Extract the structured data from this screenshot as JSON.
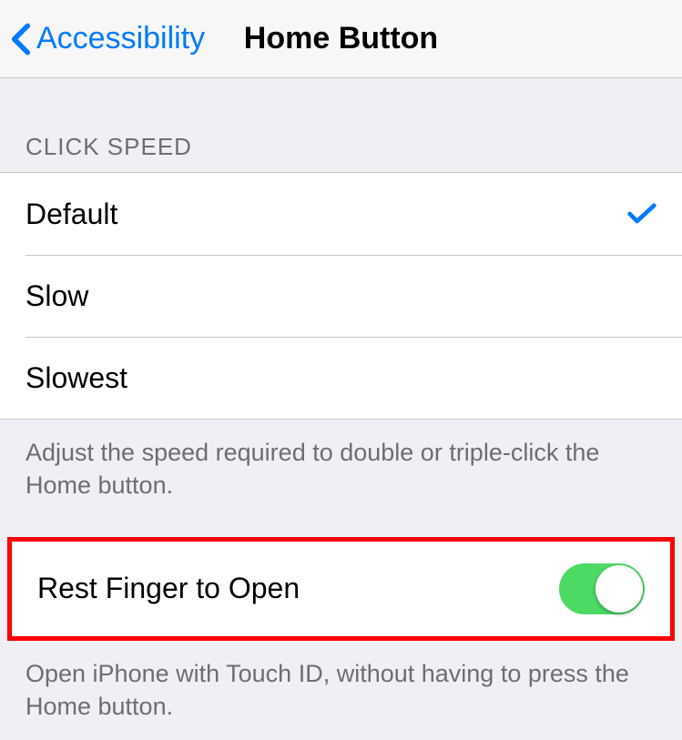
{
  "nav": {
    "back_label": "Accessibility",
    "title": "Home Button"
  },
  "click_speed": {
    "header": "Click Speed",
    "options": {
      "default": "Default",
      "slow": "Slow",
      "slowest": "Slowest"
    },
    "selected": "default",
    "footer": "Adjust the speed required to double or triple-click the Home button."
  },
  "rest_finger": {
    "label": "Rest Finger to Open",
    "enabled": true,
    "footer": "Open iPhone with Touch ID, without having to press the Home button."
  }
}
